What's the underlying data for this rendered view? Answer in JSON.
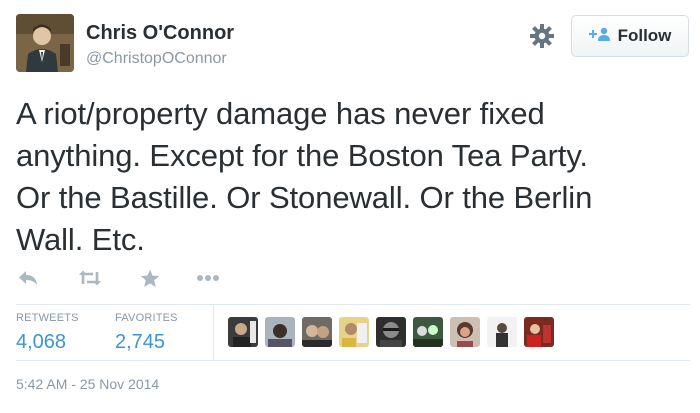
{
  "user": {
    "display_name": "Chris O'Connor",
    "handle": "@ChristopOConnor"
  },
  "follow_button": {
    "label": "Follow"
  },
  "tweet": {
    "line1": "A riot/property damage has never fixed",
    "line2": "anything. Except for the Boston Tea Party.",
    "line3": "Or the Bastille. Or Stonewall. Or the Berlin",
    "line4": "Wall. Etc."
  },
  "actions": {
    "icons": [
      "reply-icon",
      "retweet-icon",
      "favorite-icon",
      "more-icon"
    ]
  },
  "stats": {
    "retweets_label": "RETWEETS",
    "retweets_value": "4,068",
    "favorites_label": "FAVORITES",
    "favorites_value": "2,745"
  },
  "timestamp": "5:42 AM - 25 Nov 2014",
  "colors": {
    "link_blue": "#3b94d9",
    "muted_gray": "#8899a6",
    "text_dark": "#292f33"
  }
}
